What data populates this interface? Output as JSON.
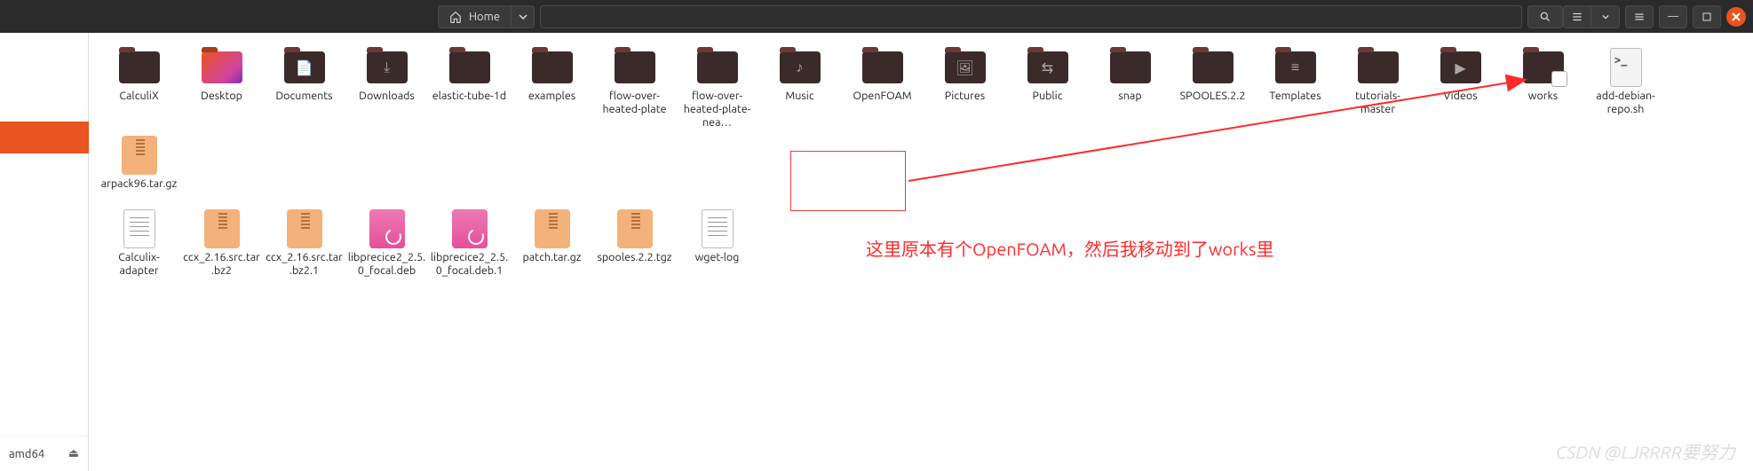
{
  "header": {
    "home_label": "Home"
  },
  "sidebar": {
    "device_label": "amd64"
  },
  "row1": [
    {
      "name": "CalculiX",
      "type": "folder"
    },
    {
      "name": "Desktop",
      "type": "desktop"
    },
    {
      "name": "Documents",
      "type": "folder",
      "glyph": "📄"
    },
    {
      "name": "Downloads",
      "type": "folder",
      "glyph": "⤓"
    },
    {
      "name": "elastic-tube-1d",
      "type": "folder"
    },
    {
      "name": "examples",
      "type": "folder"
    },
    {
      "name": "flow-over-heated-plate",
      "type": "folder"
    },
    {
      "name": "flow-over-heated-plate-nea…",
      "type": "folder"
    },
    {
      "name": "Music",
      "type": "folder",
      "glyph": "♪"
    },
    {
      "name": "OpenFOAM",
      "type": "folder"
    },
    {
      "name": "Pictures",
      "type": "folder",
      "glyph": "🖼"
    },
    {
      "name": "Public",
      "type": "folder",
      "glyph": "⇆"
    },
    {
      "name": "snap",
      "type": "folder"
    },
    {
      "name": "SPOOLES.2.2",
      "type": "folder"
    },
    {
      "name": "Templates",
      "type": "folder",
      "glyph": "≡"
    },
    {
      "name": "tutorials-master",
      "type": "folder"
    },
    {
      "name": "Videos",
      "type": "folder",
      "glyph": "▶"
    },
    {
      "name": "works",
      "type": "linked-folder"
    },
    {
      "name": "add-debian-repo.sh",
      "type": "sh"
    },
    {
      "name": "arpack96.tar.gz",
      "type": "archive"
    }
  ],
  "row2": [
    {
      "name": "Calculix-adapter",
      "type": "text"
    },
    {
      "name": "ccx_2.16.src.tar.bz2",
      "type": "archive"
    },
    {
      "name": "ccx_2.16.src.tar.bz2.1",
      "type": "archive"
    },
    {
      "name": "libprecice2_2.5.0_focal.deb",
      "type": "deb"
    },
    {
      "name": "libprecice2_2.5.0_focal.deb.1",
      "type": "deb"
    },
    {
      "name": "patch.tar.gz",
      "type": "archive"
    },
    {
      "name": "spooles.2.2.tgz",
      "type": "archive"
    },
    {
      "name": "wget-log",
      "type": "text"
    }
  ],
  "annotation": {
    "text": "这里原本有个OpenFOAM，然后我移动到了works里"
  },
  "watermark": "CSDN @LJRRRR要努力",
  "colors": {
    "accent": "#e95420",
    "annotation": "#ff2a2a"
  }
}
